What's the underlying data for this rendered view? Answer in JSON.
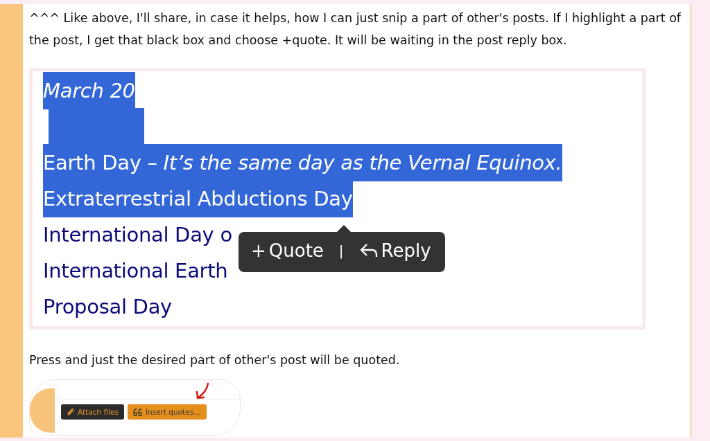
{
  "intro": "^^^ Like above, I'll share, in case it helps, how I can just snip a part of other's posts. If I highlight a part of the post, I get that black box and choose +quote. It will be waiting in the post reply box.",
  "quote_lines": [
    {
      "text": "March 20",
      "italic": true,
      "selected": true
    },
    {
      "selected": true
    },
    {
      "text": "Earth Day – *It’s the same day as the Vernal Equinox.*",
      "selected": true
    },
    {
      "text": "Extraterrestrial Abductions Day",
      "selected": true
    },
    {
      "text": "International Day o",
      "selected": false
    },
    {
      "text": "International Earth",
      "selected": false
    },
    {
      "text": "Proposal Day",
      "selected": false
    }
  ],
  "popup": {
    "plus": "+",
    "quote": "Quote",
    "separator": "|",
    "reply": "Reply"
  },
  "outro": "Press and just the desired part of other's post will be quoted.",
  "editor_buttons": [
    {
      "label": "Attach files",
      "kind": "attach"
    },
    {
      "label": "Insert quotes…",
      "kind": "quotes"
    }
  ]
}
